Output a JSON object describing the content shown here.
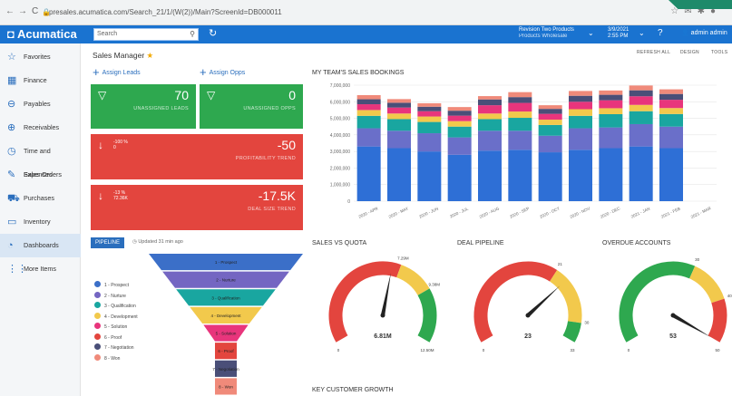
{
  "browser": {
    "url": "presales.acumatica.com/Search_21/1/(W(2))/Main?ScreenId=DB000011"
  },
  "topbar": {
    "logo": "Acumatica",
    "search_placeholder": "Search",
    "branch": "Revision Two Products",
    "branch_sub": "Products Wholesale",
    "date": "3/9/2021",
    "time": "2:55 PM",
    "user": "admin admin"
  },
  "sidebar": {
    "items": [
      {
        "label": "Favorites",
        "icon": "star-icon"
      },
      {
        "label": "Finance",
        "icon": "calculator-icon"
      },
      {
        "label": "Payables",
        "icon": "minus-circle-icon"
      },
      {
        "label": "Receivables",
        "icon": "plus-circle-icon"
      },
      {
        "label": "Time and Expenses",
        "icon": "clock-icon"
      },
      {
        "label": "Sales Orders",
        "icon": "edit-icon"
      },
      {
        "label": "Purchases",
        "icon": "cart-icon"
      },
      {
        "label": "Inventory",
        "icon": "truck-icon"
      },
      {
        "label": "Dashboards",
        "icon": "dashboard-icon"
      },
      {
        "label": "More Items",
        "icon": "grid-icon"
      }
    ]
  },
  "page": {
    "title": "Sales Manager",
    "actions": [
      "REFRESH ALL",
      "DESIGN",
      "TOOLS"
    ]
  },
  "links": {
    "assign_leads": "Assign Leads",
    "assign_opps": "Assign Opps"
  },
  "tiles": {
    "leads": {
      "value": "70",
      "label": "UNASSIGNED LEADS"
    },
    "opps": {
      "value": "0",
      "label": "UNASSIGNED OPPS"
    },
    "profit": {
      "value": "-50",
      "label": "PROFITABILITY TREND",
      "pct": "-100 %",
      "sub": "0"
    },
    "deal": {
      "value": "-17.5K",
      "label": "DEAL SIZE TREND",
      "pct": "-13 %",
      "sub": "72.36K"
    }
  },
  "colors": {
    "brand": "#1a73d0",
    "green": "#2ea84f",
    "red": "#e3453e",
    "yellow": "#f2c94c"
  },
  "pipeline_widget": {
    "tab": "PIPELINE",
    "updated": "Updated 31 min ago"
  },
  "funnel": {
    "stages": [
      "1 - Prospect",
      "2 - Nurture",
      "3 - Qualification",
      "4 - Development",
      "5 - Solution",
      "6 - Proof",
      "7 - Negotiation",
      "8 - Won"
    ],
    "labels": [
      "1 - Prospect",
      "2 - Nurture",
      "3 - Qualification",
      "4 - Development",
      "5 - Solution",
      "6 - Proof",
      "7 - Negotiation",
      "8 - Won"
    ],
    "colors": [
      "#3b6fc8",
      "#7466c2",
      "#19a6a0",
      "#f2c94c",
      "#e8357c",
      "#e3453e",
      "#4a4f78",
      "#f08a7a"
    ]
  },
  "bookings": {
    "title": "MY TEAM'S SALES BOOKINGS"
  },
  "chart_data": [
    {
      "type": "bar",
      "stacked": true,
      "title": "MY TEAM'S SALES BOOKINGS",
      "categories": [
        "2020 - APR",
        "2020 - MAY",
        "2020 - JUN",
        "2020 - JUL",
        "2020 - AUG",
        "2020 - SEP",
        "2020 - OCT",
        "2020 - NOV",
        "2020 - DEC",
        "2021 - JAN",
        "2021 - FEB",
        "2021 - MAR"
      ],
      "ylim": [
        0,
        7000000
      ],
      "yticks": [
        "0",
        "1,000,000",
        "2,000,000",
        "3,000,000",
        "4,000,000",
        "5,000,000",
        "6,000,000",
        "7,000,000"
      ],
      "series": [
        {
          "values": [
            3300000,
            3200000,
            3000000,
            2800000,
            3050000,
            3100000,
            2950000,
            3100000,
            3200000,
            3300000,
            3200000,
            0
          ],
          "color": "#2e6fd6"
        },
        {
          "values": [
            1100000,
            1050000,
            1100000,
            1050000,
            1200000,
            1150000,
            1000000,
            1300000,
            1250000,
            1350000,
            1300000,
            0
          ],
          "color": "#6a6fc9"
        },
        {
          "values": [
            750000,
            700000,
            680000,
            650000,
            700000,
            780000,
            650000,
            750000,
            800000,
            780000,
            760000,
            0
          ],
          "color": "#19a6a0"
        },
        {
          "values": [
            350000,
            340000,
            330000,
            330000,
            340000,
            380000,
            320000,
            400000,
            360000,
            380000,
            360000,
            0
          ],
          "color": "#f2c94c"
        },
        {
          "values": [
            350000,
            360000,
            320000,
            330000,
            500000,
            520000,
            350000,
            450000,
            480000,
            520000,
            500000,
            0
          ],
          "color": "#e8357c"
        },
        {
          "values": [
            300000,
            290000,
            270000,
            300000,
            350000,
            350000,
            300000,
            360000,
            330000,
            360000,
            350000,
            0
          ],
          "color": "#4a4f78"
        },
        {
          "values": [
            250000,
            220000,
            210000,
            220000,
            200000,
            300000,
            220000,
            290000,
            260000,
            290000,
            280000,
            0
          ],
          "color": "#f08a7a"
        }
      ]
    },
    {
      "type": "gauge",
      "title": "SALES VS QUOTA",
      "value": 6810000,
      "value_label": "6.81M",
      "min": 0,
      "max": 12500000,
      "min_label": "0",
      "max_label": "12.50M",
      "thresholds": [
        7290000,
        9380000
      ],
      "threshold_labels": [
        "7.29M",
        "9.38M"
      ]
    },
    {
      "type": "gauge",
      "title": "DEAL PIPELINE",
      "value": 23,
      "value_label": "23",
      "min": 0,
      "max": 33,
      "min_label": "0",
      "max_label": "33",
      "thresholds": [
        21,
        30
      ],
      "threshold_labels": [
        "21",
        "30"
      ]
    },
    {
      "type": "gauge",
      "title": "OVERDUE ACCOUNTS",
      "value": 53,
      "value_label": "53",
      "min": 0,
      "max": 50,
      "min_label": "0",
      "max_label": "50",
      "thresholds": [
        30,
        40
      ],
      "threshold_labels": [
        "30",
        "40"
      ]
    }
  ],
  "sections": {
    "key_customer": "KEY CUSTOMER GROWTH"
  }
}
